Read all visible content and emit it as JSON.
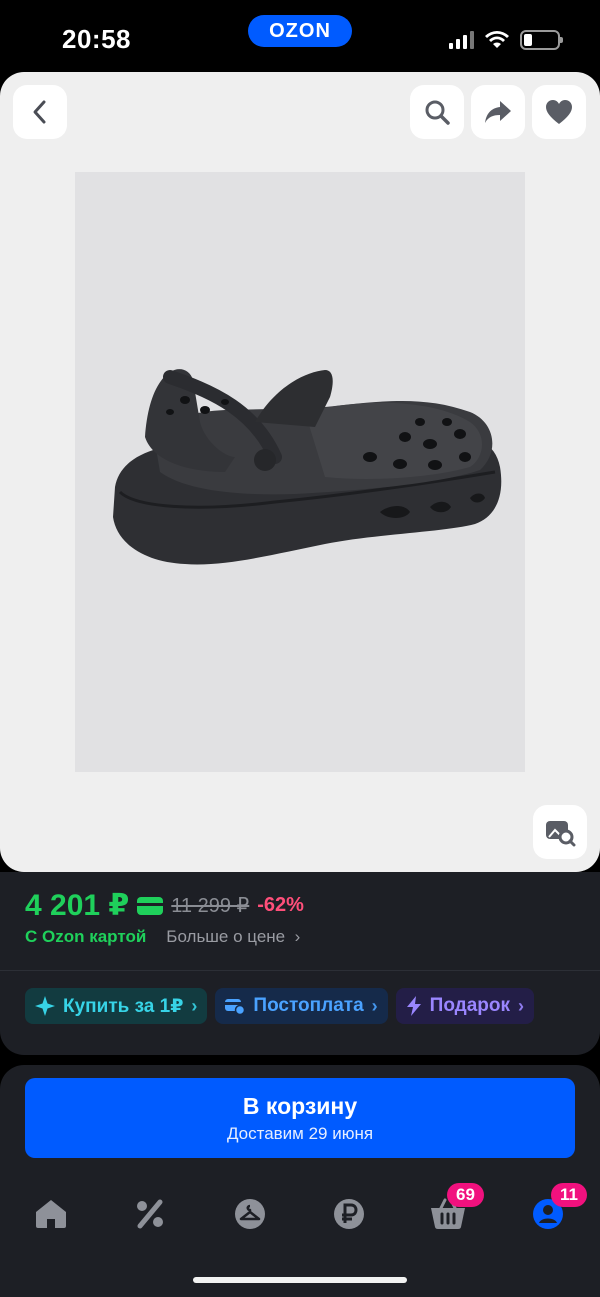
{
  "status_bar": {
    "time": "20:58",
    "logo": "OZON"
  },
  "header_actions": {
    "back_icon": "chevron-left-icon",
    "search_icon": "search-icon",
    "share_icon": "share-icon",
    "favorite_icon": "heart-icon",
    "image_search_icon": "image-search-icon"
  },
  "price": {
    "current": "4 201 ₽",
    "old": "11 299 ₽",
    "discount": "-62%",
    "card_note": "С Ozon картой",
    "more_link": "Больше о цене"
  },
  "chips": [
    {
      "label": "Купить за 1₽",
      "icon": "sparkle-icon"
    },
    {
      "label": "Постоплата",
      "icon": "postpay-icon"
    },
    {
      "label": "Подарок",
      "icon": "lightning-icon"
    }
  ],
  "cart": {
    "title": "В корзину",
    "subtitle": "Доставим 29 июня"
  },
  "tabbar": {
    "cart_badge": "69",
    "profile_badge": "11"
  },
  "colors": {
    "brand_blue": "#005bff",
    "price_green": "#1fd05b",
    "discount_pink": "#ff4f7a",
    "badge_pink": "#f1117e"
  }
}
